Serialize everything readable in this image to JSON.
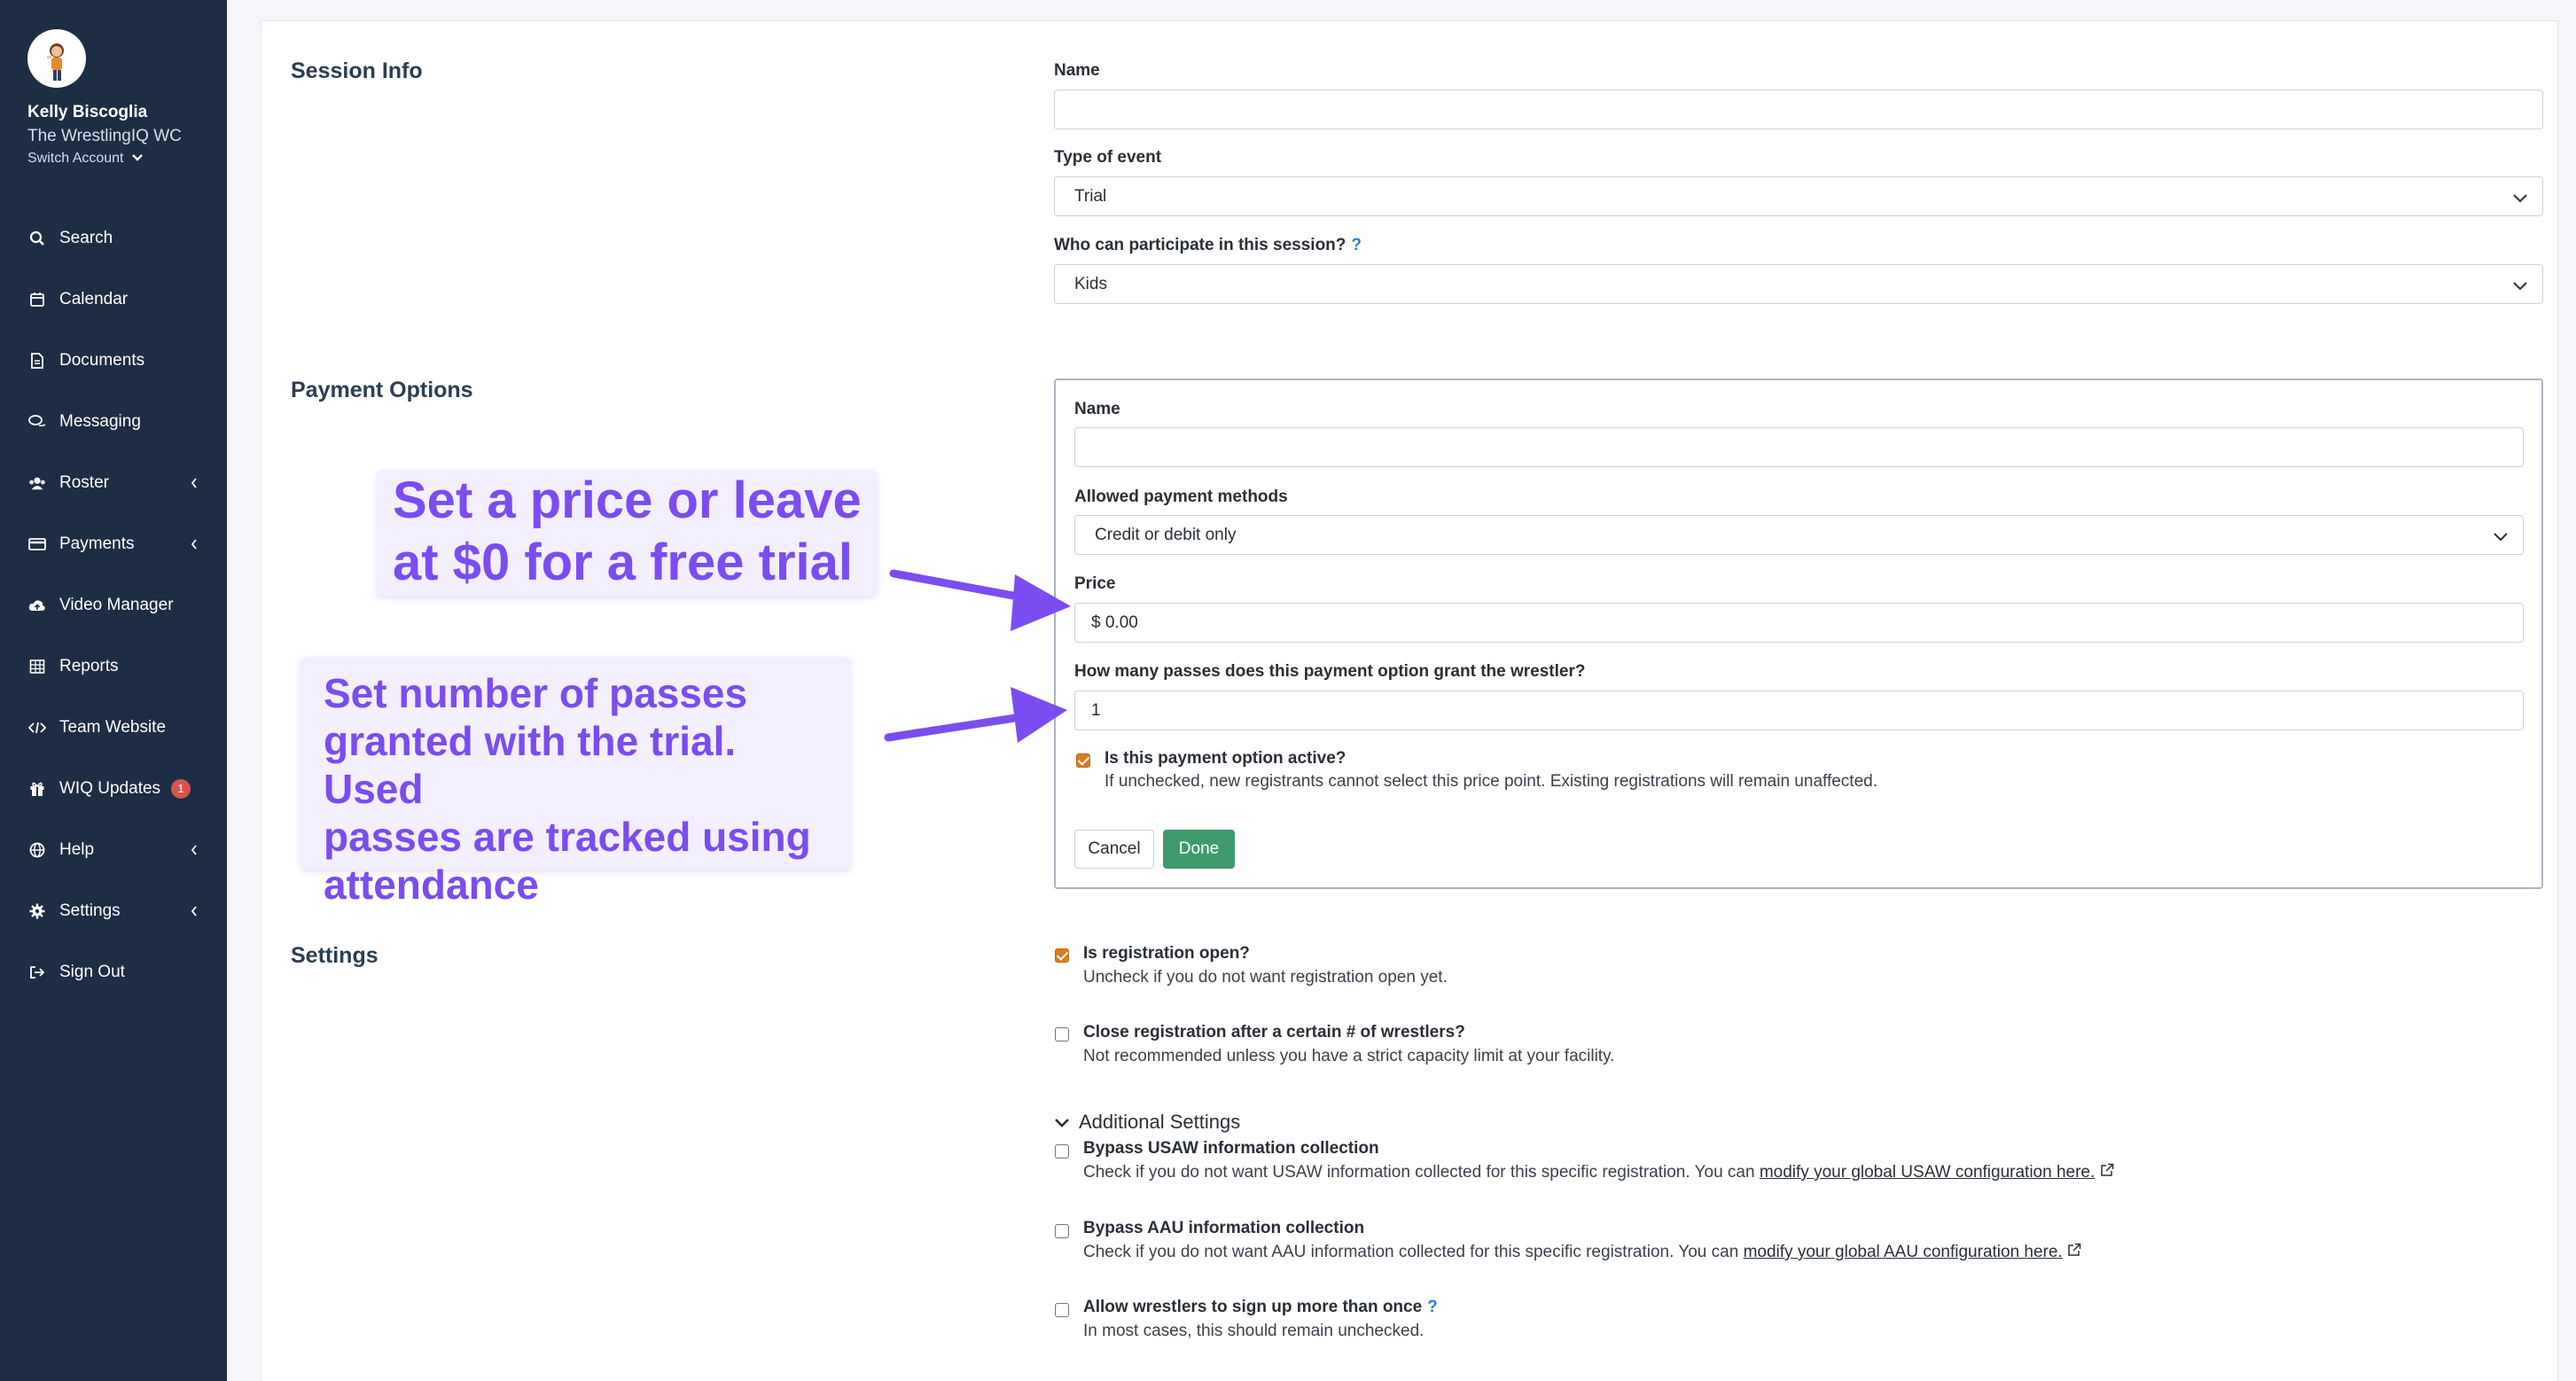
{
  "user": {
    "name": "Kelly Biscoglia",
    "team": "The WrestlingIQ WC",
    "switch_account": "Switch Account"
  },
  "nav": [
    {
      "label": "Search",
      "icon": "search-icon"
    },
    {
      "label": "Calendar",
      "icon": "calendar-icon"
    },
    {
      "label": "Documents",
      "icon": "document-icon"
    },
    {
      "label": "Messaging",
      "icon": "messaging-icon"
    },
    {
      "label": "Roster",
      "icon": "users-icon"
    },
    {
      "label": "Payments",
      "icon": "credit-card-icon"
    },
    {
      "label": "Video Manager",
      "icon": "cloud-upload-icon"
    },
    {
      "label": "Reports",
      "icon": "table-icon"
    },
    {
      "label": "Team Website",
      "icon": "code-icon"
    },
    {
      "label": "WIQ Updates",
      "icon": "gift-icon",
      "badge": "1"
    },
    {
      "label": "Help",
      "icon": "globe-icon"
    },
    {
      "label": "Settings",
      "icon": "gear-icon"
    },
    {
      "label": "Sign Out",
      "icon": "sign-out-icon"
    }
  ],
  "session": {
    "title": "Session Info",
    "name_label": "Name",
    "name_value": "",
    "type_label": "Type of event",
    "type_value": "Trial",
    "who_label": "Who can participate in this session?",
    "who_help": "?",
    "who_value": "Kids"
  },
  "payment": {
    "title": "Payment Options",
    "name_label": "Name",
    "name_value": "",
    "methods_label": "Allowed payment methods",
    "methods_value": "Credit or debit only",
    "price_label": "Price",
    "price_value": "$ 0.00",
    "passes_label": "How many passes does this payment option grant the wrestler?",
    "passes_value": "1",
    "active_label": "Is this payment option active?",
    "active_desc": "If unchecked, new registrants cannot select this price point. Existing registrations will remain unaffected.",
    "cancel": "Cancel",
    "done": "Done"
  },
  "settings": {
    "title": "Settings",
    "reg_open_label": "Is registration open?",
    "reg_open_desc": "Uncheck if you do not want registration open yet.",
    "close_reg_label": "Close registration after a certain # of wrestlers?",
    "close_reg_desc": "Not recommended unless you have a strict capacity limit at your facility.",
    "additional": "Additional Settings",
    "usaw_label": "Bypass USAW information collection",
    "usaw_desc": "Check if you do not want USAW information collected for this specific registration. You can",
    "usaw_link": "modify your global USAW configuration here.",
    "aau_label": "Bypass AAU information collection",
    "aau_desc": "Check if you do not want AAU information collected for this specific registration. You can",
    "aau_link": "modify your global AAU configuration here.",
    "multi_label": "Allow wrestlers to sign up more than once",
    "multi_help": "?",
    "multi_desc": "In most cases, this should remain unchecked."
  },
  "annotations": {
    "price_line1": "Set a price or leave",
    "price_line2": "at $0 for a free trial",
    "passes_line1": "Set number of passes",
    "passes_line2": "granted with the trial. Used",
    "passes_line3": "passes are tracked using",
    "passes_line4": "attendance"
  },
  "colors": {
    "sidebar": "#1d2d44",
    "accent_checkbox": "#e07a1f",
    "done_button": "#3f9a6c",
    "annotation": "#7b4cf0",
    "annotation_bg": "#f3efff"
  }
}
